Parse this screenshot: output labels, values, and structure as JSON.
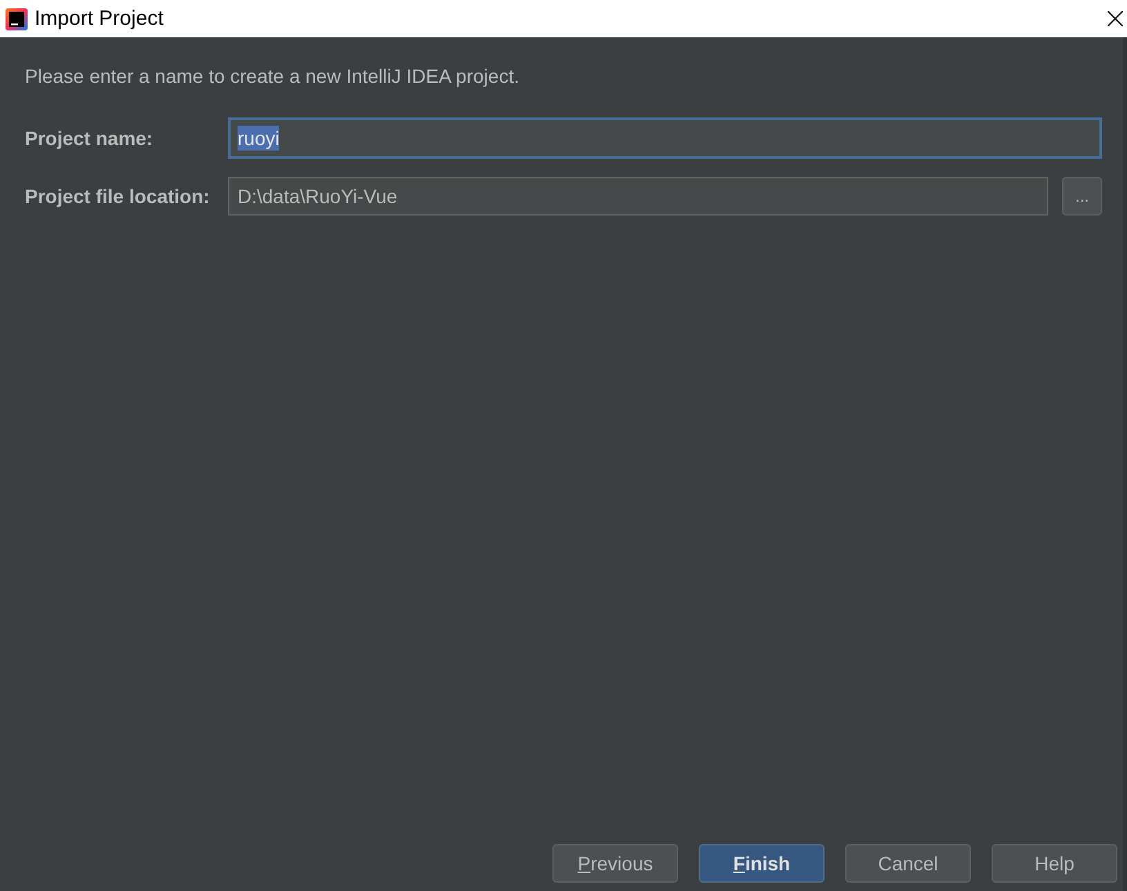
{
  "window": {
    "title": "Import Project"
  },
  "description": "Please enter a name to create a new IntelliJ IDEA project.",
  "fields": [
    {
      "label": "Project name:",
      "value": "ruoyi",
      "focused": true,
      "value_highlighted": true
    },
    {
      "label": "Project file location:",
      "value": "D:\\data\\RuoYi-Vue",
      "focused": false,
      "value_highlighted": false,
      "browse_button": "..."
    }
  ],
  "buttons": [
    {
      "label": "Previous",
      "mnemonic": true,
      "default": false
    },
    {
      "label": "Finish",
      "mnemonic": true,
      "default": true
    },
    {
      "label": "Cancel",
      "mnemonic": false,
      "default": false
    },
    {
      "label": "Help",
      "mnemonic": false,
      "default": false
    }
  ]
}
